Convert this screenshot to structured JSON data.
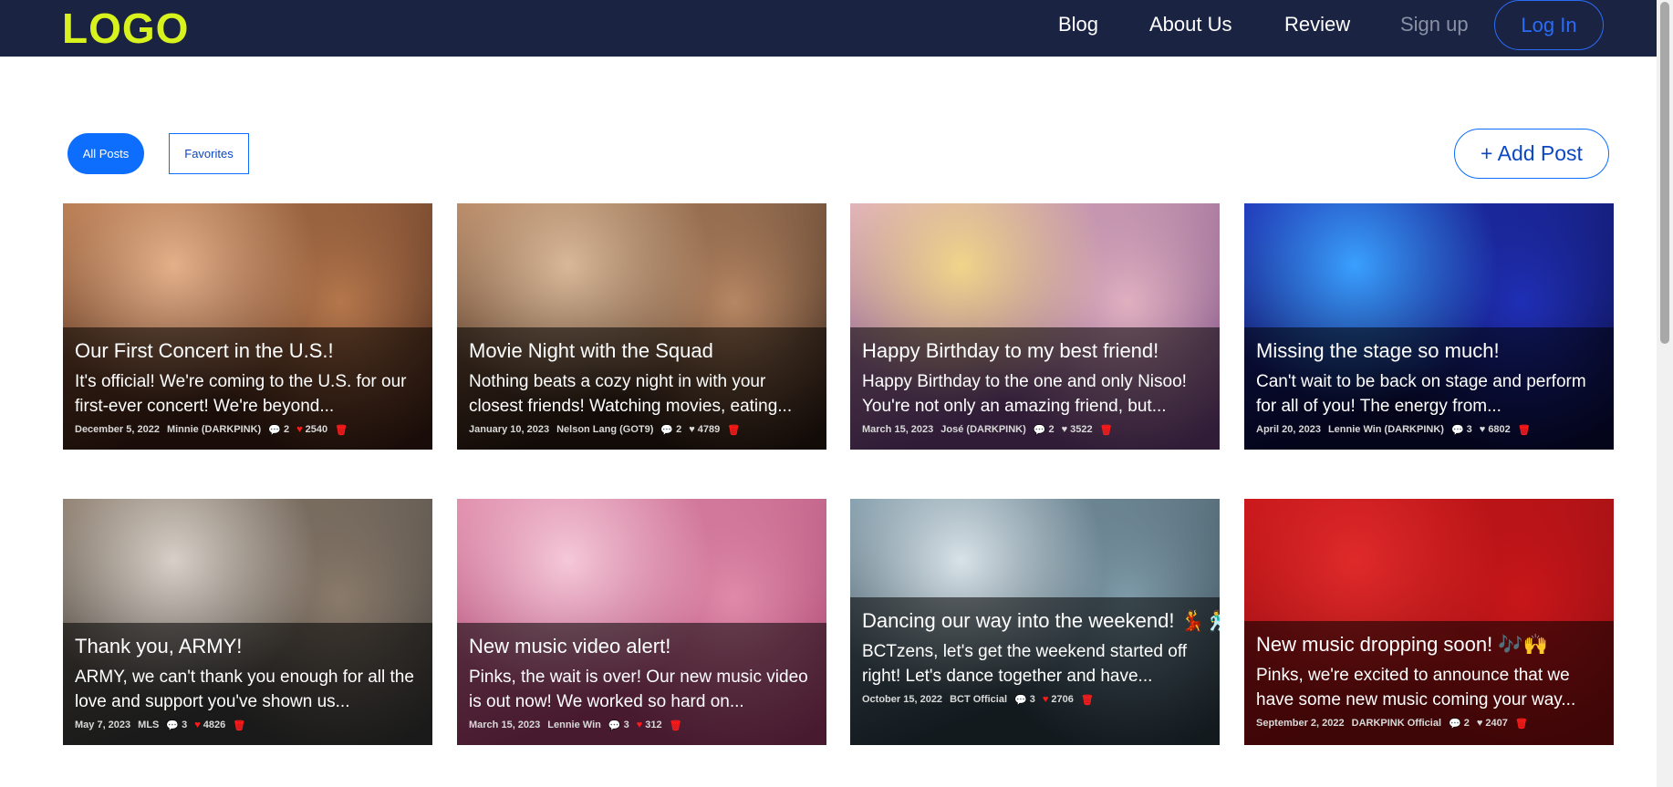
{
  "nav": {
    "logo": "LOGO",
    "links": [
      "Blog",
      "About Us",
      "Review",
      "Sign up"
    ],
    "login": "Log In"
  },
  "filters": {
    "all_posts": "All Posts",
    "favorites": "Favorites"
  },
  "add_post": "+ Add Post",
  "posts": [
    {
      "title": "Our First Concert in the U.S.!",
      "text": "It's official! We're coming to the U.S. for our first-ever concert! We're beyond...",
      "date": "December 5, 2022",
      "author": "Minnie (DARKPINK)",
      "comments": "2",
      "likes": "2540",
      "liked": true,
      "colors": [
        "#3a1d14",
        "#b5774c",
        "#e3b08a"
      ]
    },
    {
      "title": "Movie Night with the Squad",
      "text": "Nothing beats a cozy night in with your closest friends! Watching movies, eating...",
      "date": "January 10, 2023",
      "author": "Nelson Lang (GOT9)",
      "comments": "2",
      "likes": "4789",
      "liked": false,
      "colors": [
        "#2a1a12",
        "#b78763",
        "#d8b898"
      ]
    },
    {
      "title": "Happy Birthday to my best friend!",
      "text": "Happy Birthday to the one and only Nisoo! You're not only an amazing friend, but...",
      "date": "March 15, 2023",
      "author": "José (DARKPINK)",
      "comments": "2",
      "likes": "3522",
      "liked": false,
      "colors": [
        "#6b3e7a",
        "#e0b0c0",
        "#f0d58a"
      ]
    },
    {
      "title": "Missing the stage so much!",
      "text": "Can't wait to be back on stage and perform for all of you! The energy from...",
      "date": "April 20, 2023",
      "author": "Lennie Win (DARKPINK)",
      "comments": "3",
      "likes": "6802",
      "liked": false,
      "colors": [
        "#0a0b3a",
        "#1f2fb5",
        "#3aa0ff"
      ]
    },
    {
      "title": "Thank you, ARMY!",
      "text": "ARMY, we can't thank you enough for all the love and support you've shown us...",
      "date": "May 7, 2023",
      "author": "MLS",
      "comments": "3",
      "likes": "4826",
      "liked": true,
      "colors": [
        "#3a3a3a",
        "#8a7a6a",
        "#d8d0c8"
      ]
    },
    {
      "title": "New music video alert!",
      "text": "Pinks, the wait is over! Our new music video is out now! We worked so hard on...",
      "date": "March 15, 2023",
      "author": "Lennie Win",
      "comments": "3",
      "likes": "312",
      "liked": true,
      "colors": [
        "#a03a6a",
        "#e08aa8",
        "#f5c8d8"
      ]
    },
    {
      "title": "Dancing our way into the weekend! 💃🕺",
      "text": "BCTzens, let's get the weekend started off right! Let's dance together and have...",
      "date": "October 15, 2022",
      "author": "BCT Official",
      "comments": "3",
      "likes": "2706",
      "liked": true,
      "colors": [
        "#2a3a44",
        "#7e9aa8",
        "#d8e2e8"
      ]
    },
    {
      "title": "New music dropping soon! 🎶🙌",
      "text": "Pinks, we're excited to announce that we have some new music coming your way...",
      "date": "September 2, 2022",
      "author": "DARKPINK Official",
      "comments": "2",
      "likes": "2407",
      "liked": false,
      "colors": [
        "#8a0e10",
        "#c8161a",
        "#e02a2a"
      ]
    }
  ]
}
